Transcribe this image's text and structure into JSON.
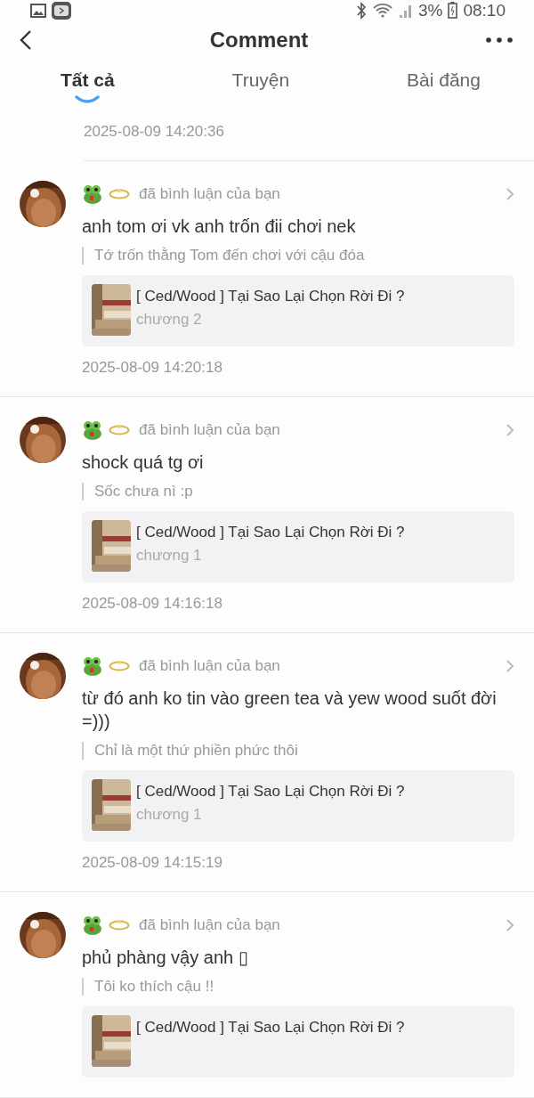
{
  "status_bar": {
    "battery": "3%",
    "time": "08:10"
  },
  "header": {
    "title": "Comment"
  },
  "tabs": [
    {
      "label": "Tất cả",
      "selected": true
    },
    {
      "label": "Truyện",
      "selected": false
    },
    {
      "label": "Bài đăng",
      "selected": false
    }
  ],
  "top_timestamp": "2025-08-09 14:20:36",
  "comments": [
    {
      "action": "đã bình luận của bạn",
      "text": "anh tom ơi vk anh trốn đii chơi nek",
      "reply": "Tớ trốn thằng Tom đến chơi với cậu đóa",
      "story": {
        "title": "[ Ced/Wood ] Tại Sao Lại Chọn Rời Đi ?",
        "chapter": "chương 2"
      },
      "timestamp": "2025-08-09 14:20:18"
    },
    {
      "action": "đã bình luận của bạn",
      "text": "shock quá tg ơi",
      "reply": "Sốc chưa nì :p",
      "story": {
        "title": "[ Ced/Wood ] Tại Sao Lại Chọn Rời Đi ?",
        "chapter": "chương 1"
      },
      "timestamp": "2025-08-09 14:16:18"
    },
    {
      "action": "đã bình luận của bạn",
      "text": "từ đó anh ko tin vào green tea và yew wood suốt đời =)))",
      "reply": "Chỉ là một thứ phiền phức thôi",
      "story": {
        "title": "[ Ced/Wood ] Tại Sao Lại Chọn Rời Đi ?",
        "chapter": "chương 1"
      },
      "timestamp": "2025-08-09 14:15:19"
    },
    {
      "action": "đã bình luận của bạn",
      "text": "phủ phàng vậy anh ▯",
      "reply": "Tôi ko thích cậu !!",
      "story": {
        "title": "[ Ced/Wood ] Tại Sao Lại Chọn Rời Đi ?"
      }
    }
  ]
}
